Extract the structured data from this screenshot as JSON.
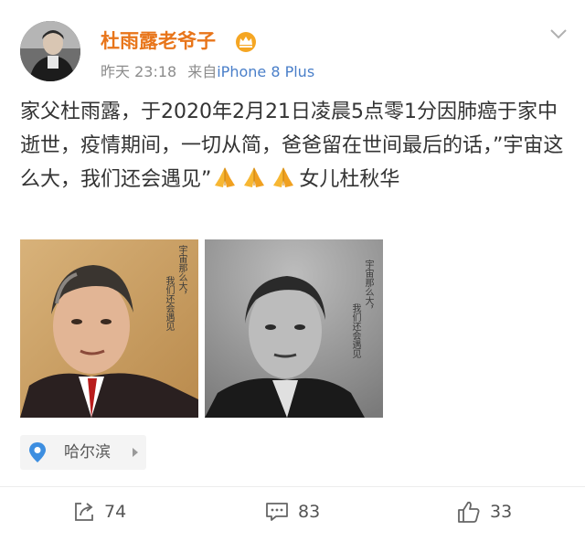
{
  "post": {
    "author": "杜雨露老爷子",
    "time": "昨天 23:18",
    "source_prefix": "来自",
    "source_device": "iPhone 8 Plus",
    "text_segments": [
      "家父杜雨露，于2020年2月21日凌晨5点零1分因肺癌于家中逝世，疫情期间，一切从简，爸爸留在世间最后的话，”宇宙这么大，我们还会遇见”",
      "女儿杜秋华"
    ],
    "emoji": [
      "folded-hands",
      "folded-hands",
      "folded-hands"
    ],
    "images": [
      {
        "caption_lines": [
          "宇宙那么大，",
          "我们还会遇见"
        ]
      },
      {
        "caption_lines": [
          "宇宙那么大，",
          "我们还会遇见"
        ]
      }
    ],
    "location": "哈尔滨",
    "stats": {
      "reposts": "74",
      "comments": "83",
      "likes": "33"
    },
    "colors": {
      "author": "#e8751a",
      "source_link": "#4a7fc9",
      "location_pin": "#3d8ee0"
    }
  }
}
